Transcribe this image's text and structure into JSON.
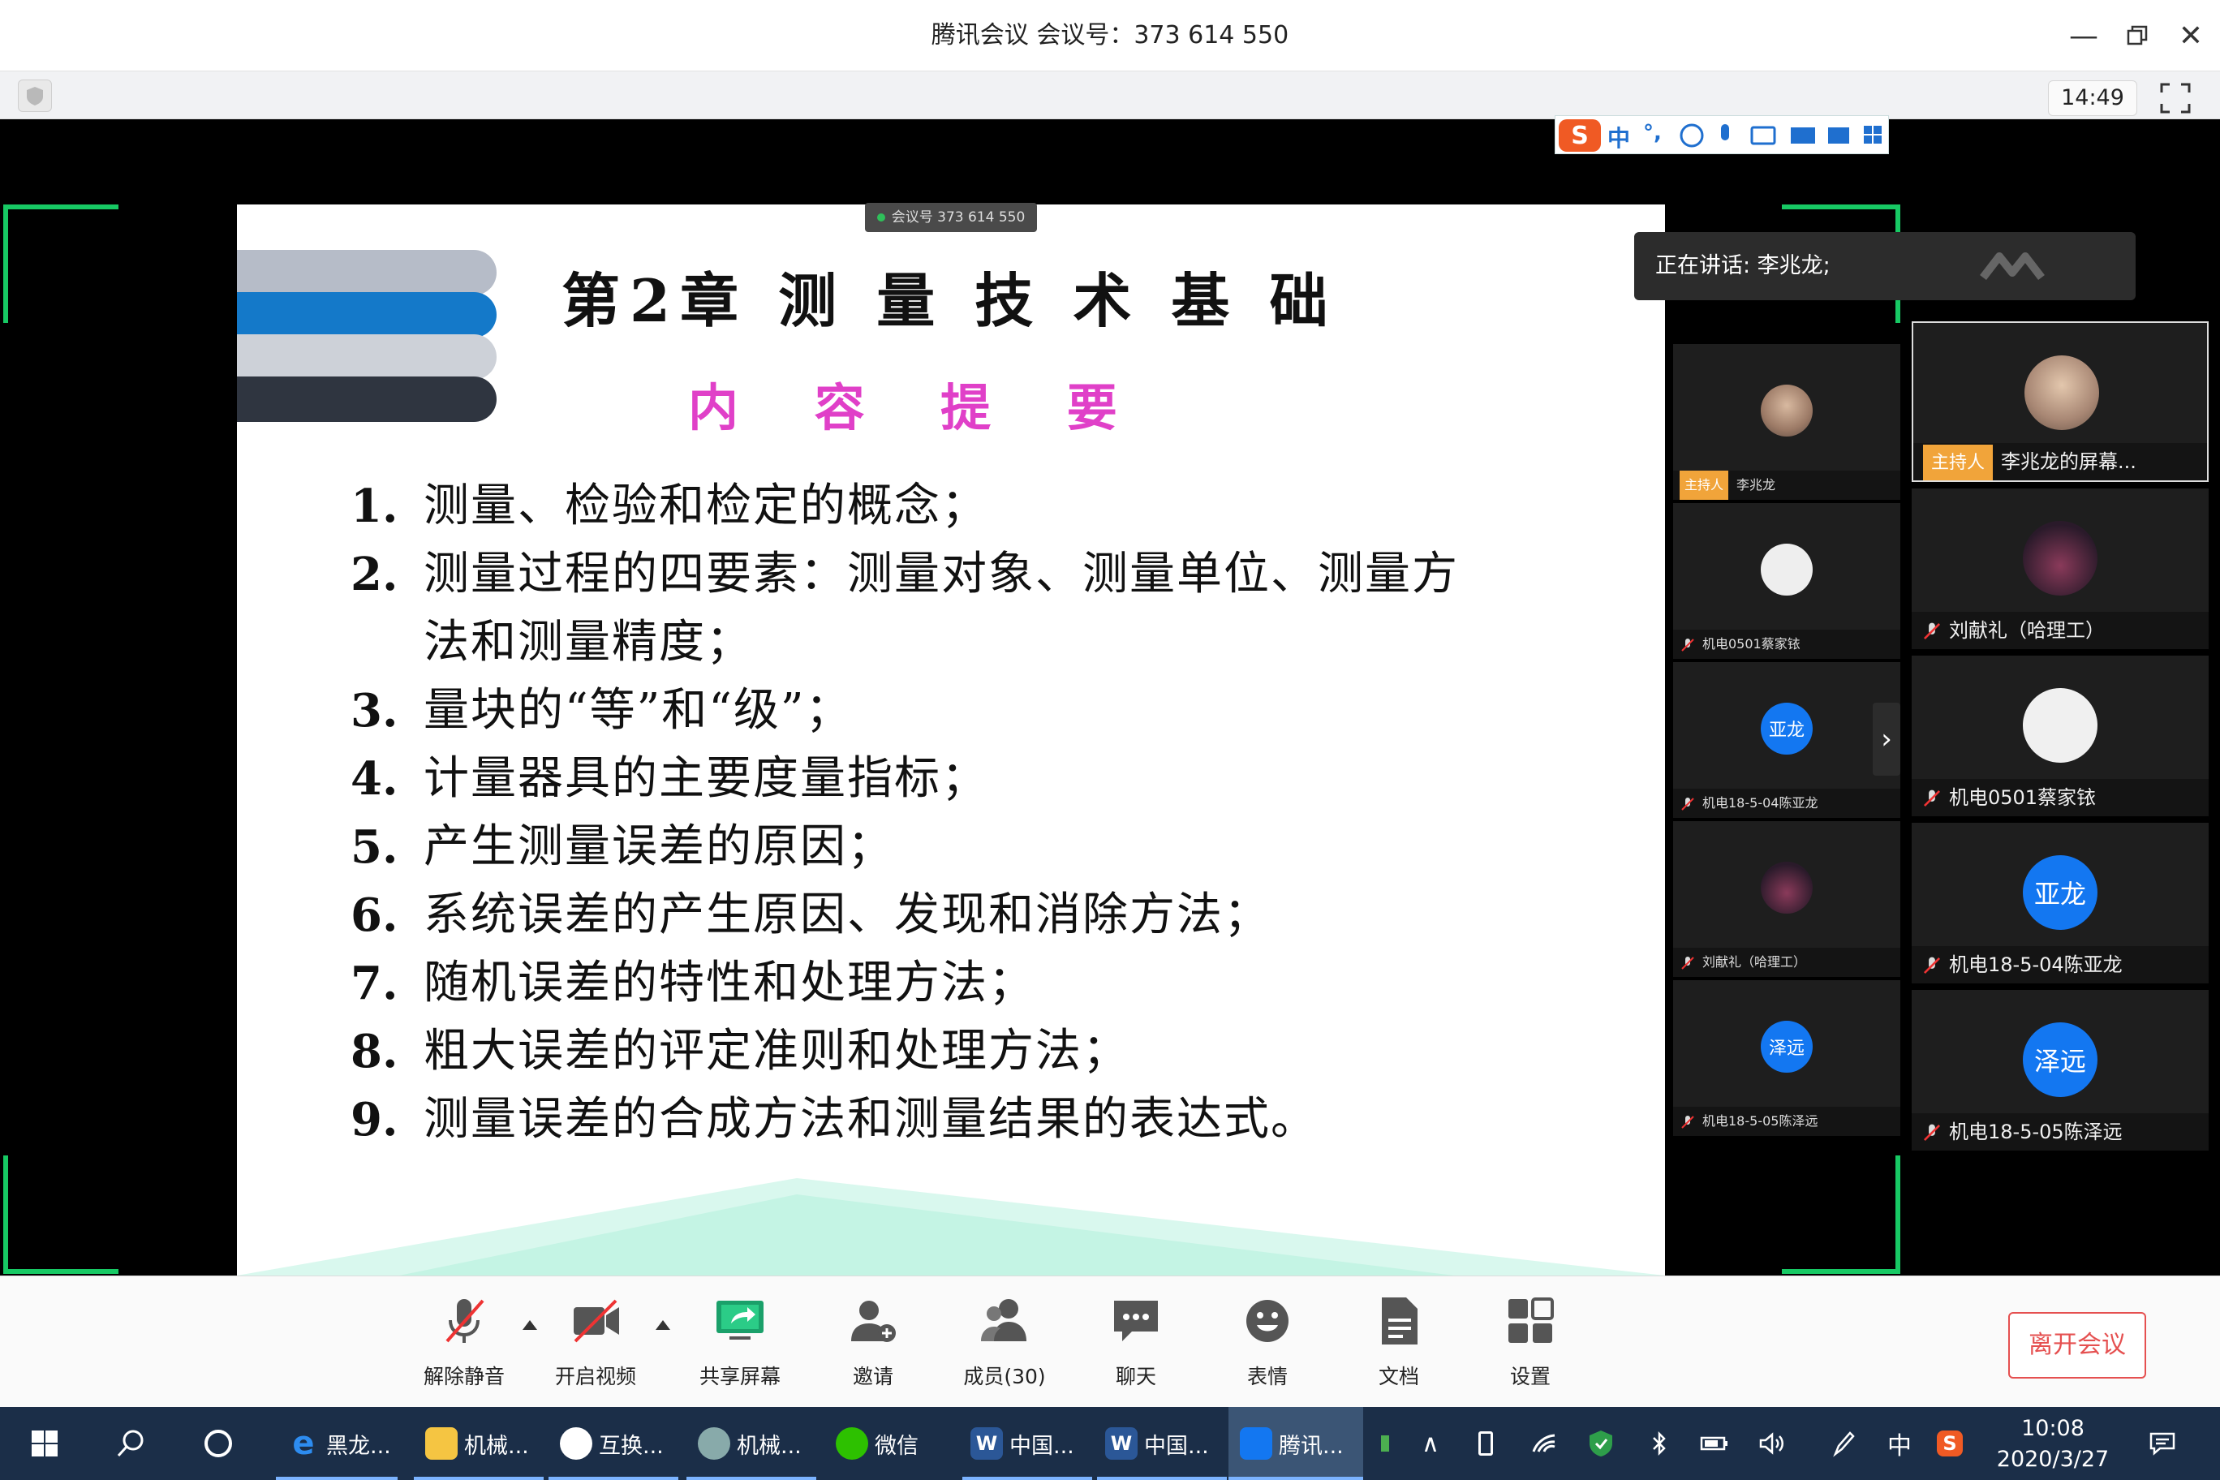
{
  "window": {
    "title": "腾讯会议 会议号：373 614 550",
    "time": "14:49",
    "meeting_chip": "会议号 373 614 550"
  },
  "slide": {
    "title": "第2章  测 量 技 术 基 础",
    "subtitle": "内 容 提 要",
    "items": [
      {
        "num": "1.",
        "text": "测量、检验和检定的概念；"
      },
      {
        "num": "2.",
        "text": "测量过程的四要素：测量对象、测量单位、测量方"
      },
      {
        "num": "",
        "text": "法和测量精度；"
      },
      {
        "num": "3.",
        "text": "量块的“等”和“级”；"
      },
      {
        "num": "4.",
        "text": "计量器具的主要度量指标；"
      },
      {
        "num": "5.",
        "text": "产生测量误差的原因；"
      },
      {
        "num": "6.",
        "text": "系统误差的产生原因、发现和消除方法；"
      },
      {
        "num": "7.",
        "text": "随机误差的特性和处理方法；"
      },
      {
        "num": "8.",
        "text": "粗大误差的评定准则和处理方法；"
      },
      {
        "num": "9.",
        "text": "测量误差的合成方法和测量结果的表达式。"
      }
    ]
  },
  "speaking": "正在讲话: 李兆龙;",
  "gallery_small": [
    {
      "host": "主持人",
      "name": "李兆龙"
    },
    {
      "name": "机电0501蔡家铱"
    },
    {
      "avatar_text": "亚龙",
      "name": "机电18-5-04陈亚龙"
    },
    {
      "name": "刘献礼（哈理工）"
    },
    {
      "avatar_text": "泽远",
      "name": "机电18-5-05陈泽远"
    }
  ],
  "gallery_large": [
    {
      "host": "主持人",
      "name": "李兆龙的屏幕..."
    },
    {
      "name": "刘献礼（哈理工）"
    },
    {
      "name": "机电0501蔡家铱"
    },
    {
      "avatar_text": "亚龙",
      "name": "机电18-5-04陈亚龙"
    },
    {
      "avatar_text": "泽远",
      "name": "机电18-5-05陈泽远"
    }
  ],
  "ime": {
    "lang": "中",
    "punct": "°,"
  },
  "toolbar": {
    "unmute": "解除静音",
    "video": "开启视频",
    "share": "共享屏幕",
    "invite": "邀请",
    "members": "成员(30)",
    "chat": "聊天",
    "emoji": "表情",
    "docs": "文档",
    "settings": "设置",
    "leave": "离开会议"
  },
  "taskbar": {
    "apps": [
      "黑龙...",
      "机械...",
      "互换...",
      "机械...",
      "微信",
      "中国...",
      "中国...",
      "腾讯..."
    ],
    "ime": "中",
    "time": "10:08",
    "date": "2020/3/27"
  },
  "colors": {
    "accent_green": "#17c964",
    "brand_blue": "#1377f1",
    "leave_red": "#e55050",
    "host_orange": "#f1a43a"
  }
}
